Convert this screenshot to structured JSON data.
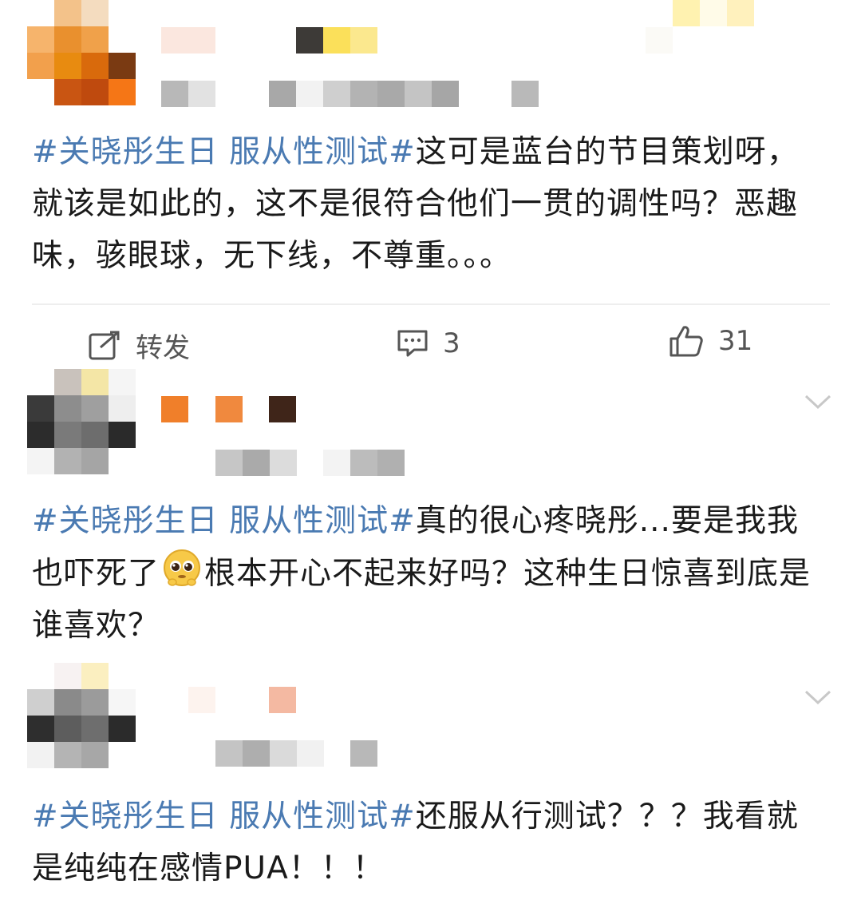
{
  "posts": [
    {
      "hashtag": "#关晓彤生日 服从性测试#",
      "text": "这可是蓝台的节目策划呀，就该是如此的，这不是很符合他们一贯的调性吗？恶趣味，骇眼球，无下线，不尊重。。。",
      "actions": {
        "repost_label": "转发",
        "comment_count": "3",
        "like_count": "31"
      }
    },
    {
      "hashtag": "#关晓彤生日 服从性测试#",
      "text_before_emoji": "真的很心疼晓彤...要是我我也吓死了",
      "emoji": "pleading-face",
      "text_after_emoji": "根本开心不起来好吗？这种生日惊喜到底是谁喜欢？"
    },
    {
      "hashtag": "#关晓彤生日 服从性测试#",
      "text": "还服从行测试？？？我看就是纯纯在感情PUA！！！"
    }
  ],
  "icons": [
    "repost-icon",
    "comment-icon",
    "like-icon",
    "chevron-down-icon"
  ],
  "colors": {
    "hashtag": "#4a7ab2",
    "text": "#1a1a1a",
    "secondary": "#555555"
  }
}
